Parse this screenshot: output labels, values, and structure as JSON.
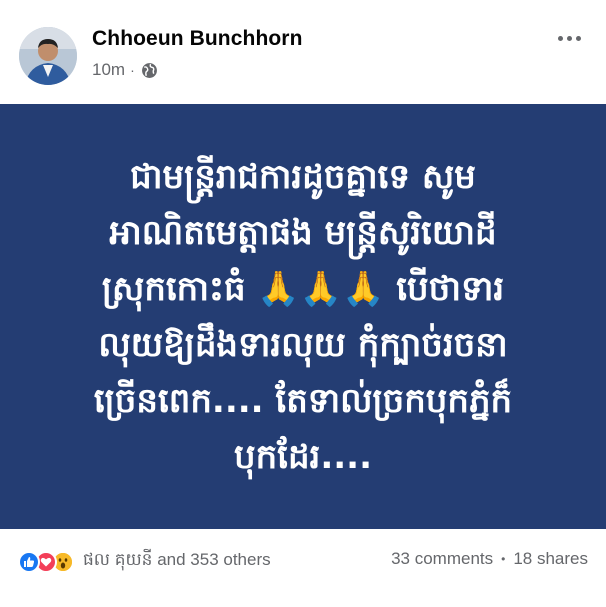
{
  "post": {
    "author": "Chhoeun Bunchhorn",
    "time": "10m",
    "separator": "·",
    "audience_icon": "globe-icon",
    "more_icon": "more-horizontal-icon",
    "background_color": "#243d73",
    "text": "ជាមន្ត្រីរាជការដូចគ្នាទេ សូម\nអាណិតមេត្តាផង មន្ត្រីសូរិយោដី\nស្រុកកោះធំ 🙏🙏🙏 បើថាទារ\nលុយឱ្យដឹងទារលុយ កុំក្បាច់រចនា\nច្រើនពេក.... តែទាល់ច្រកបុកភ្នំក៏\nបុកដែរ...."
  },
  "reactions": {
    "icons": [
      "like-icon",
      "love-icon",
      "wow-icon"
    ],
    "summary": "ផល គុយនី and 353 others"
  },
  "stats": {
    "comments": "33 comments",
    "separator": "•",
    "shares": "18 shares"
  }
}
